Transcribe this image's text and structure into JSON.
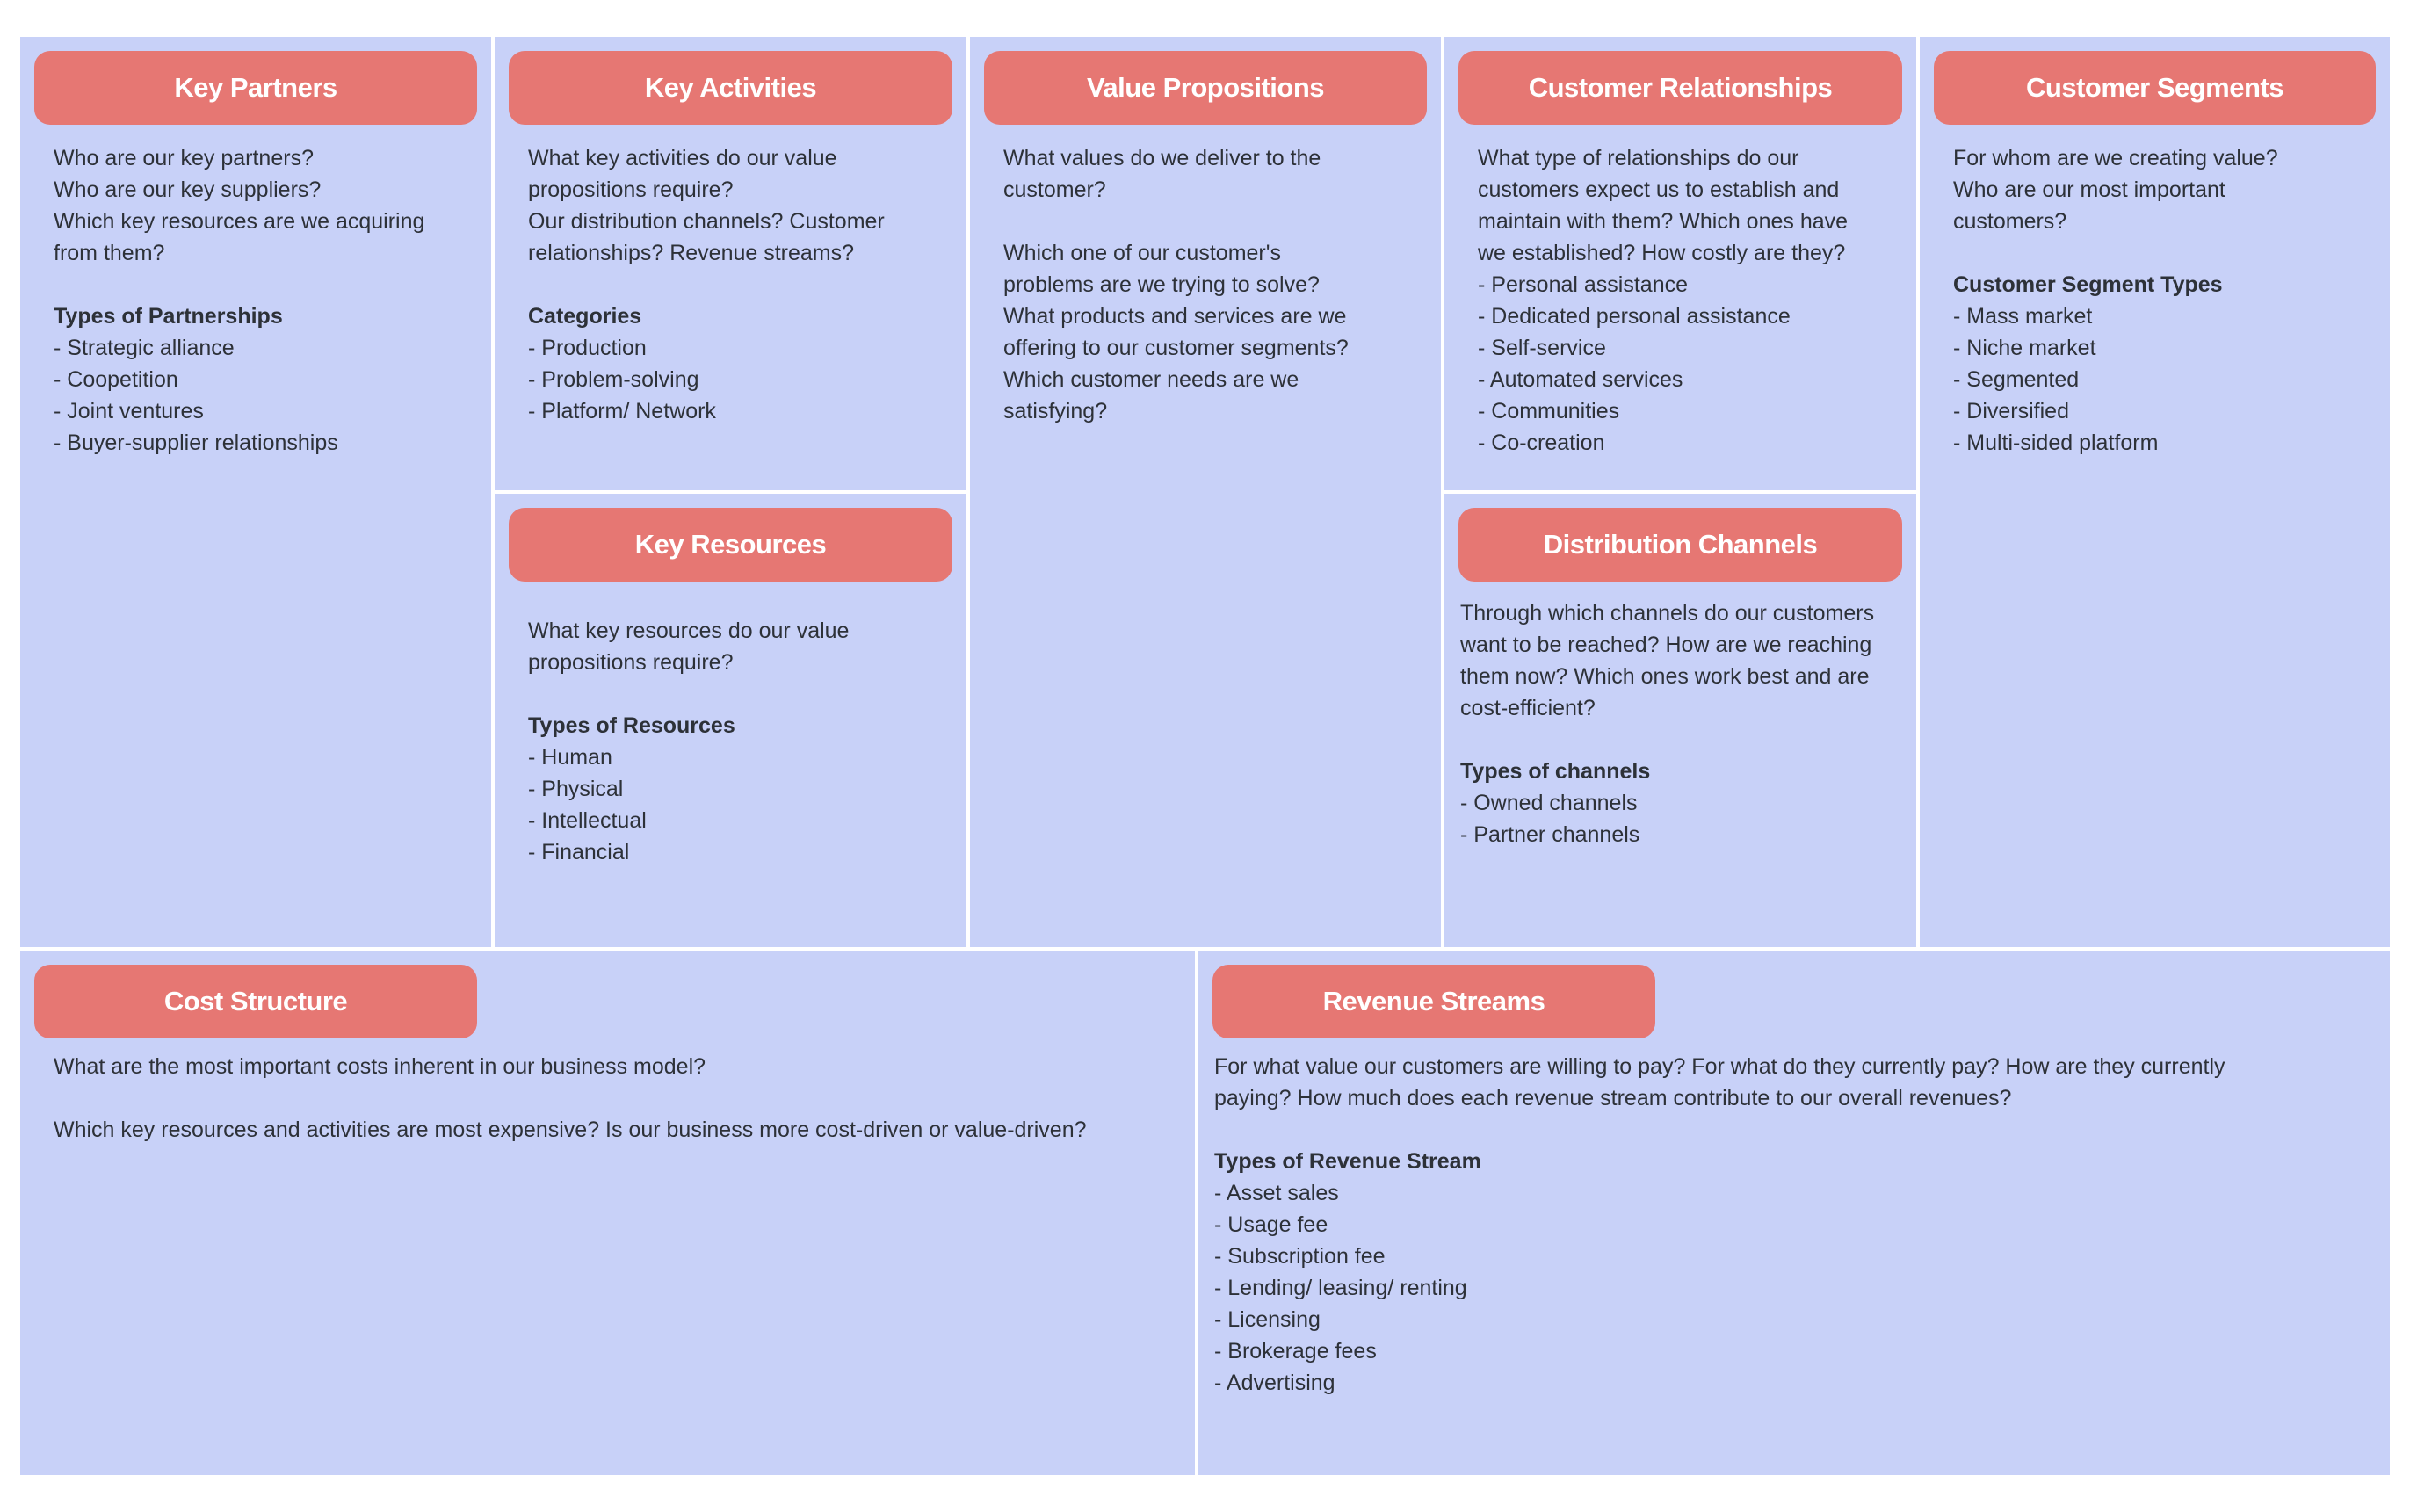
{
  "canvas": {
    "colors": {
      "cell_bg": "#c8d1f8",
      "header_bg": "#e67773",
      "header_text": "#ffffff",
      "body_text": "#2d3138",
      "divider": "#ffffff"
    },
    "blocks": {
      "key_partners": {
        "title": "Key Partners",
        "intro": [
          "Who are our key partners?",
          "Who are our key suppliers?",
          "Which key resources are we acquiring",
          "from them?"
        ],
        "heading": "Types of Partnerships",
        "items": [
          "- Strategic alliance",
          "- Coopetition",
          "- Joint ventures",
          "- Buyer-supplier relationships"
        ]
      },
      "key_activities": {
        "title": "Key Activities",
        "intro": [
          "What key activities do our value",
          "propositions require?",
          "Our distribution channels?  Customer",
          "relationships? Revenue streams?"
        ],
        "heading": "Categories",
        "items": [
          "- Production",
          "- Problem-solving",
          "- Platform/ Network"
        ]
      },
      "key_resources": {
        "title": "Key Resources",
        "intro": [
          "What key resources do our value",
          "propositions require?"
        ],
        "heading": "Types of Resources",
        "items": [
          "- Human",
          "- Physical",
          "- Intellectual",
          "- Financial"
        ]
      },
      "value_propositions": {
        "title": "Value Propositions",
        "intro": [
          "What values do we deliver to the",
          "customer?"
        ],
        "paragraph2": [
          "Which one of our customer's",
          "problems are we trying to solve?",
          "What products and services are we",
          "offering to our customer segments?",
          "Which customer needs are we",
          "satisfying?"
        ]
      },
      "customer_relationships": {
        "title": "Customer Relationships",
        "intro": [
          "What type of relationships do our",
          "customers expect us to establish and",
          "maintain with them? Which ones have",
          "we established? How costly are they?"
        ],
        "items": [
          "- Personal assistance",
          "- Dedicated personal assistance",
          "- Self-service",
          "- Automated services",
          "- Communities",
          "- Co-creation"
        ]
      },
      "distribution_channels": {
        "title": "Distribution Channels",
        "intro": [
          "Through which channels do our customers",
          "want to be reached? How are we reaching",
          "them now? Which ones work best and are",
          "cost-efficient?"
        ],
        "heading": "Types of channels",
        "items": [
          "- Owned channels",
          "- Partner channels"
        ]
      },
      "customer_segments": {
        "title": "Customer Segments",
        "intro": [
          "For whom are we creating value?",
          "Who are our most important",
          "customers?"
        ],
        "heading": "Customer Segment Types",
        "items": [
          "- Mass market",
          "- Niche market",
          "- Segmented",
          "- Diversified",
          "- Multi-sided platform"
        ]
      },
      "cost_structure": {
        "title": "Cost Structure",
        "intro": [
          "What are the most important costs inherent in our business model?"
        ],
        "paragraph2": [
          "Which key resources and activities are most expensive? Is our business more cost-driven or value-driven?"
        ]
      },
      "revenue_streams": {
        "title": "Revenue Streams",
        "intro": [
          "For what value our customers are willing to pay? For what do they currently pay? How are they currently",
          "paying? How much does each revenue stream contribute to our overall revenues?"
        ],
        "heading": "Types of Revenue Stream",
        "items": [
          "- Asset sales",
          "- Usage fee",
          "- Subscription fee",
          "- Lending/ leasing/ renting",
          "- Licensing",
          "- Brokerage fees",
          "- Advertising"
        ]
      }
    }
  }
}
